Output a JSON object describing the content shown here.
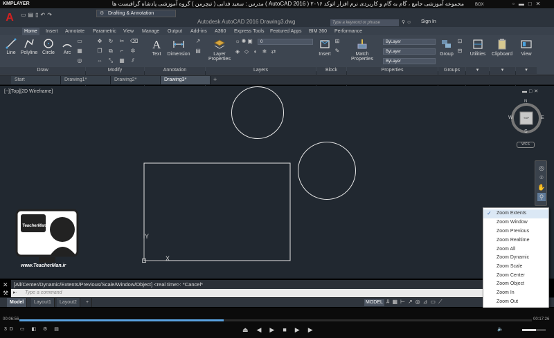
{
  "player": {
    "brand": "KMPLAYER",
    "title": "مجموعه آموزشی جامع ، گام به گام و کاربردی نرم افزار اتوکد ۲۰۱۶ ( AutoCAD 2016 )  مدرس : سعید فدایی ( تیچرمن ) گروه آموزشی پادشاه گرافیست ها",
    "box_label": "BOX",
    "elapsed": "00:06:56",
    "total": "00:17:26",
    "progress": 0.398,
    "volume": 0.6
  },
  "autocad": {
    "logo": "A",
    "workspace": "Drafting & Annotation",
    "document_title": "Autodesk AutoCAD 2016    Drawing3.dwg",
    "search_placeholder": "Type a keyword or phrase",
    "sign_in": "Sign In"
  },
  "ribbon_tabs": [
    {
      "label": "Home",
      "active": true
    },
    {
      "label": "Insert"
    },
    {
      "label": "Annotate"
    },
    {
      "label": "Parametric"
    },
    {
      "label": "View"
    },
    {
      "label": "Manage"
    },
    {
      "label": "Output"
    },
    {
      "label": "Add-ins"
    },
    {
      "label": "A360"
    },
    {
      "label": "Express Tools"
    },
    {
      "label": "Featured Apps"
    },
    {
      "label": "BIM 360"
    },
    {
      "label": "Performance"
    }
  ],
  "ribbon": {
    "draw_tools": [
      "Line",
      "Polyline",
      "Circle",
      "Arc"
    ],
    "annotation_tools": [
      "Text",
      "Dimension"
    ],
    "layer_properties": "Layer Properties",
    "layer_combo": "0",
    "insert": "Insert",
    "match_properties": "Match Properties",
    "prop_combo1": "ByLayer",
    "prop_combo2": "ByLayer",
    "prop_combo3": "ByLayer",
    "group": "Group",
    "utilities": "Utilities",
    "clipboard": "Clipboard",
    "view": "View",
    "panels": [
      "Draw",
      "Modify",
      "Annotation",
      "Layers",
      "Block",
      "Properties",
      "Groups"
    ]
  },
  "doc_tabs": [
    {
      "label": "Start"
    },
    {
      "label": "Drawing1*"
    },
    {
      "label": "Drawing2*"
    },
    {
      "label": "Drawing3*",
      "active": true
    }
  ],
  "viewport": {
    "controls": "[−][Top][2D Wireframe]",
    "viewcube_top": "TOP",
    "compass": {
      "n": "N",
      "s": "S",
      "e": "E",
      "w": "W"
    },
    "wcs": "WCS"
  },
  "watermark": {
    "brand": "TeacherMan",
    "url": "www.TeacherMan.ir"
  },
  "command": {
    "history": "[All/Center/Dynamic/Extents/Previous/Scale/Window/Object] <real time>: *Cancel*",
    "placeholder": "Type a command"
  },
  "layout_tabs": [
    {
      "label": "Model",
      "active": true
    },
    {
      "label": "Layout1"
    },
    {
      "label": "Layout2"
    }
  ],
  "status_model": "MODEL",
  "zoom_menu": [
    {
      "label": "Zoom Extents",
      "checked": true
    },
    {
      "label": "Zoom Window"
    },
    {
      "label": "Zoom Previous"
    },
    {
      "label": "Zoom Realtime"
    },
    {
      "label": "Zoom All"
    },
    {
      "label": "Zoom Dynamic"
    },
    {
      "label": "Zoom Scale"
    },
    {
      "label": "Zoom Center"
    },
    {
      "label": "Zoom Object"
    },
    {
      "label": "Zoom In"
    },
    {
      "label": "Zoom Out"
    }
  ]
}
